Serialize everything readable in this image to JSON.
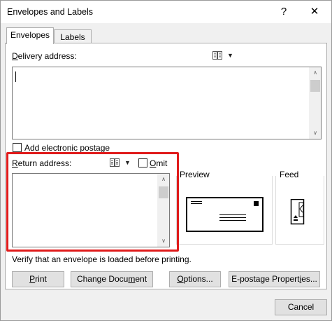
{
  "window": {
    "title": "Envelopes and Labels",
    "help_label": "?",
    "close_label": "✕"
  },
  "tabs": [
    {
      "label": "Envelopes",
      "active": true
    },
    {
      "label": "Labels",
      "active": false
    }
  ],
  "delivery": {
    "label_prefix": "",
    "label_underlined": "D",
    "label_rest": "elivery address:",
    "value": ""
  },
  "postage": {
    "label": "Add electronic postage",
    "checked": false
  },
  "return": {
    "label_underlined": "R",
    "label_rest": "eturn address:",
    "value": "",
    "omit_underlined": "O",
    "omit_rest": "mit",
    "omit_checked": false
  },
  "preview": {
    "label": "Preview"
  },
  "feed": {
    "label": "Feed"
  },
  "status_text": "Verify that an envelope is loaded before printing.",
  "buttons": {
    "print_u": "P",
    "print_rest": "rint",
    "change_doc_pre": "Change Docu",
    "change_doc_u": "m",
    "change_doc_rest": "ent",
    "options_u": "O",
    "options_rest": "ptions...",
    "epostage_pre": "E-postage Propert",
    "epostage_u": "i",
    "epostage_rest": "es...",
    "cancel": "Cancel"
  },
  "colors": {
    "highlight": "#e01b1b",
    "dialog_bg": "#f0f0f0"
  }
}
